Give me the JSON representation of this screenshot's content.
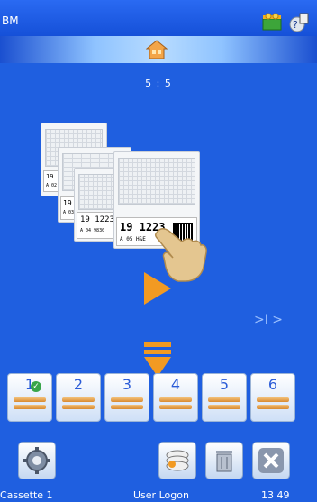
{
  "header": {
    "brand": "BM"
  },
  "counter": "5 : 5",
  "cassettes": [
    {
      "row1": "19 1",
      "row2": "A 02"
    },
    {
      "row1": "19 1",
      "row2": "A 03"
    },
    {
      "row1": "19 12234",
      "row2": "A 04 9830"
    },
    {
      "row1": "19 1223",
      "row2": "A 05 H&E"
    }
  ],
  "skip_label": ">I >",
  "slots": [
    {
      "label": "1",
      "checked": true
    },
    {
      "label": "2",
      "checked": false
    },
    {
      "label": "3",
      "checked": false
    },
    {
      "label": "4",
      "checked": false
    },
    {
      "label": "5",
      "checked": false
    },
    {
      "label": "6",
      "checked": false
    }
  ],
  "status": {
    "left": "Cassette 1",
    "center": "User Logon",
    "right": "13 49"
  },
  "colors": {
    "background": "#1f5fe0",
    "accent_orange": "#f29a22",
    "slot_number": "#2a5bd7"
  },
  "icons": [
    "cassette-status-icon",
    "help-icon",
    "home-icon",
    "play-icon",
    "touch-hand-icon",
    "down-arrow-icon",
    "settings-icon",
    "printer-stack-icon",
    "trash-icon",
    "close-icon"
  ]
}
